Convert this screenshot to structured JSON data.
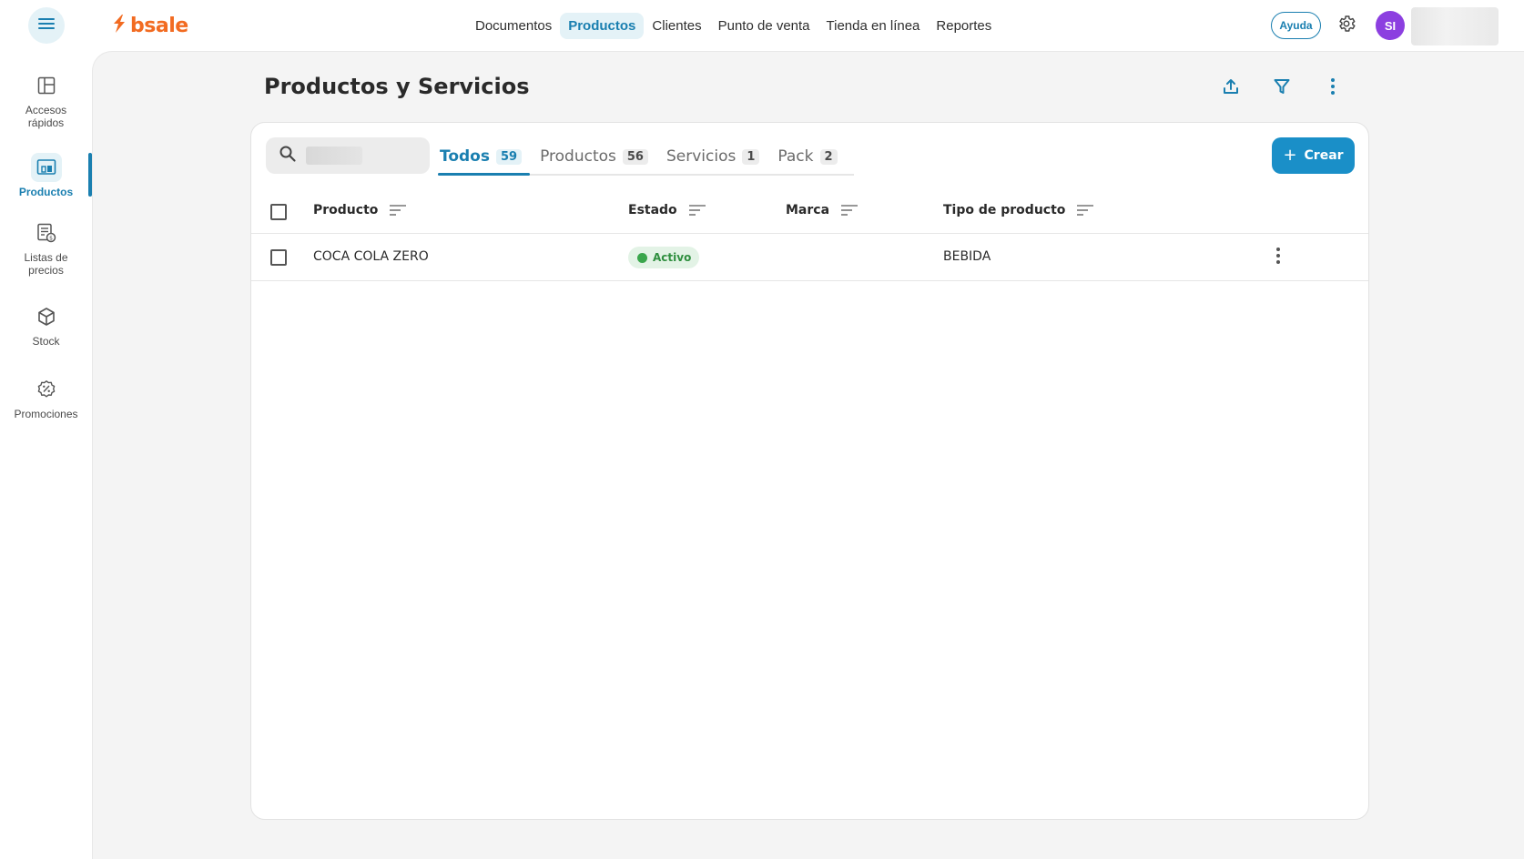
{
  "app": {
    "logo_text": "bsale",
    "brand_color": "#f26b21",
    "accent_color": "#1a7fb0"
  },
  "topnav": {
    "items": [
      {
        "label": "Documentos",
        "active": false
      },
      {
        "label": "Productos",
        "active": true
      },
      {
        "label": "Clientes",
        "active": false
      },
      {
        "label": "Punto de venta",
        "active": false
      },
      {
        "label": "Tienda en línea",
        "active": false
      },
      {
        "label": "Reportes",
        "active": false
      }
    ],
    "help_label": "Ayuda",
    "avatar_initials": "SI"
  },
  "sidebar": {
    "items": [
      {
        "label": "Accesos rápidos",
        "icon": "layout-icon"
      },
      {
        "label": "Productos",
        "icon": "products-icon",
        "active": true
      },
      {
        "label": "Listas de precios",
        "icon": "price-list-icon"
      },
      {
        "label": "Stock",
        "icon": "box-icon"
      },
      {
        "label": "Promociones",
        "icon": "promotion-icon"
      }
    ]
  },
  "page": {
    "title": "Productos y Servicios"
  },
  "tabs": [
    {
      "label": "Todos",
      "count": "59",
      "active": true
    },
    {
      "label": "Productos",
      "count": "56",
      "active": false
    },
    {
      "label": "Servicios",
      "count": "1",
      "active": false
    },
    {
      "label": "Pack",
      "count": "2",
      "active": false
    }
  ],
  "create_button": {
    "label": "Crear"
  },
  "table": {
    "columns": [
      "Producto",
      "Estado",
      "Marca",
      "Tipo de producto"
    ],
    "rows": [
      {
        "producto": "COCA COLA ZERO",
        "estado": "Activo",
        "marca": "",
        "tipo": "BEBIDA"
      }
    ]
  },
  "status_colors": {
    "active_bg": "#e3f3e6",
    "active_dot": "#3aa64c"
  }
}
